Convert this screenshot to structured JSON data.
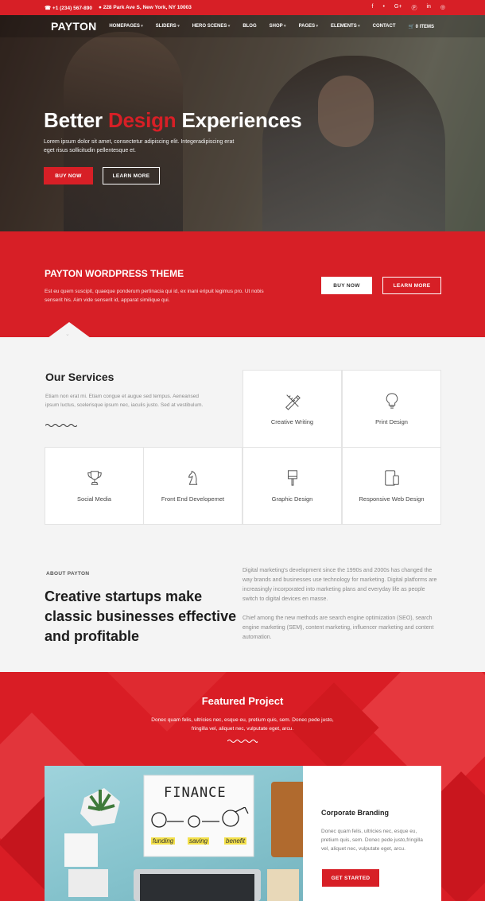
{
  "topbar": {
    "phone": "☎ +1 (234) 567-890",
    "address": "● 228 Park Ave S, New York, NY 10003",
    "social": [
      "f",
      "•",
      "G+",
      "Ⓟ",
      "in",
      "◎"
    ]
  },
  "nav": {
    "logo": "PAYTON",
    "items": [
      "HOMEPAGES",
      "SLIDERS",
      "HERO SCENES",
      "BLOG",
      "SHOP",
      "PAGES",
      "ELEMENTS",
      "CONTACT",
      "🛒 0 ITEMS"
    ]
  },
  "hero": {
    "title_part1": "Better ",
    "title_accent": "Design",
    "title_part2": " Experiences",
    "text": "Lorem ipsum dolor sit amet, consectetur adipiscing elit. Integeradipiscing erat eget risus sollicitudin pellentesque et.",
    "buy_label": "BUY NOW",
    "learn_label": "LEARN MORE"
  },
  "band": {
    "title": "PAYTON WORDPRESS THEME",
    "text": "Est eu quem suscipit, quaeque ponderum pertinacia qui id, ex inani eripuit legimus pro. Ut nobis senserit his. Aim vide senserit id, apparat similique qui.",
    "buy_label": "BUY NOW",
    "learn_label": "LEARN MORE"
  },
  "services": {
    "title": "Our Services",
    "text": "Etiam non erat mi. Etiam congue et augue sed tempus. Aeneansed ipsum luctus, scelerisque ipsum nec, iaculis justo. Sed at vestibulum.",
    "items": [
      {
        "label": "Creative Writing",
        "icon": "pencil-ruler-icon"
      },
      {
        "label": "Print Design",
        "icon": "lightbulb-icon"
      },
      {
        "label": "Social Media",
        "icon": "trophy-icon"
      },
      {
        "label": "Front End Developemet",
        "icon": "chess-knight-icon"
      },
      {
        "label": "Graphic Design",
        "icon": "paint-brush-icon"
      },
      {
        "label": "Responsive Web Design",
        "icon": "devices-icon"
      }
    ]
  },
  "about": {
    "kicker": "ABOUT PAYTON",
    "title": "Creative startups make classic businesses effective and profitable",
    "p1": "Digital marketing's development since the 1990s and 2000s has changed the way brands and businesses use technology for marketing. Digital platforms are increasingly incorporated into marketing plans and everyday life as people switch to digital devices en masse.",
    "p2": "Chief among the new methods are search engine optimization (SEO), search engine marketing (SEM), content marketing, influencer marketing and content automation."
  },
  "featured": {
    "title": "Featured Project",
    "text": "Donec quam felis, ultricies nec, esque eu, pretium quis, sem. Donec pede justo, fringilla vel, aliquet nec, vulputate eget, arcu.",
    "card": {
      "image_board_text": "FINANCE",
      "image_words": [
        "funding",
        "saving",
        "benefit"
      ],
      "title": "Corporate Branding",
      "text": "Donec quam felis, ultricies nec, esque eu, pretium quis, sem. Donec pede justo,fringilla vel, aliquet nec, vulputate eget, arcu.",
      "button_label": "GET STARTED"
    }
  },
  "colors": {
    "accent": "#d71f26",
    "light_bg": "#f4f4f4"
  }
}
